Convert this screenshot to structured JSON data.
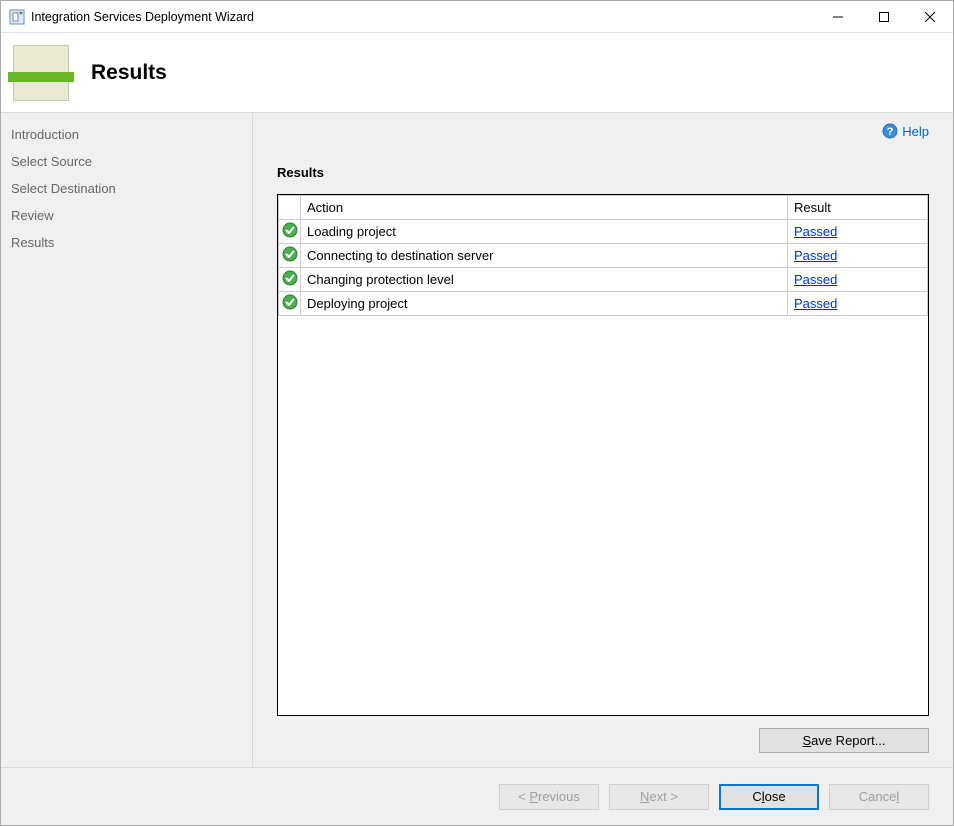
{
  "titlebar": {
    "title": "Integration Services Deployment Wizard"
  },
  "header": {
    "title": "Results"
  },
  "sidebar": {
    "items": [
      {
        "label": "Introduction"
      },
      {
        "label": "Select Source"
      },
      {
        "label": "Select Destination"
      },
      {
        "label": "Review"
      },
      {
        "label": "Results"
      }
    ]
  },
  "main": {
    "help_label": "Help",
    "section_title": "Results",
    "columns": {
      "action": "Action",
      "result": "Result"
    },
    "rows": [
      {
        "action": "Loading project",
        "result": "Passed"
      },
      {
        "action": "Connecting to destination server",
        "result": "Passed"
      },
      {
        "action": "Changing protection level",
        "result": "Passed"
      },
      {
        "action": "Deploying project",
        "result": "Passed"
      }
    ],
    "save_report_label": "Save Report..."
  },
  "footer": {
    "previous": "< Previous",
    "next": "Next >",
    "close": "Close",
    "cancel": "Cancel"
  }
}
